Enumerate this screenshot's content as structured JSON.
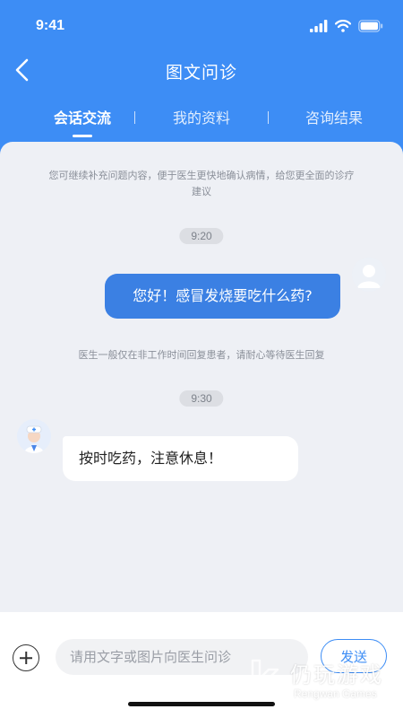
{
  "status_bar": {
    "time": "9:41"
  },
  "header": {
    "title": "图文问诊",
    "back_icon": "chevron-left-icon",
    "tabs": [
      {
        "label": "会话交流",
        "active": true
      },
      {
        "label": "我的资料",
        "active": false
      },
      {
        "label": "咨询结果",
        "active": false
      }
    ],
    "divider": "|"
  },
  "chat": {
    "intro_notice": "您可继续补充问题内容，便于医生更快地确认病情，给您更全面的诊疗建议",
    "messages": [
      {
        "time": "9:20",
        "sender": "patient",
        "text": "您好！感冒发烧要吃什么药?"
      },
      {
        "notice": "医生一般仅在非工作时间回复患者，请耐心等待医生回复"
      },
      {
        "time": "9:30",
        "sender": "doctor",
        "text": "按时吃药，注意休息！"
      }
    ]
  },
  "input_bar": {
    "plus_icon": "plus-circle-icon",
    "placeholder": "请用文字或图片向医生问诊",
    "send_label": "发送"
  },
  "watermark": {
    "cn": "仍玩游戏",
    "en": "Rengwan Games"
  },
  "colors": {
    "primary": "#3d8df5",
    "patient_bubble": "#3b80e3",
    "chat_bg": "#eef0f5"
  }
}
